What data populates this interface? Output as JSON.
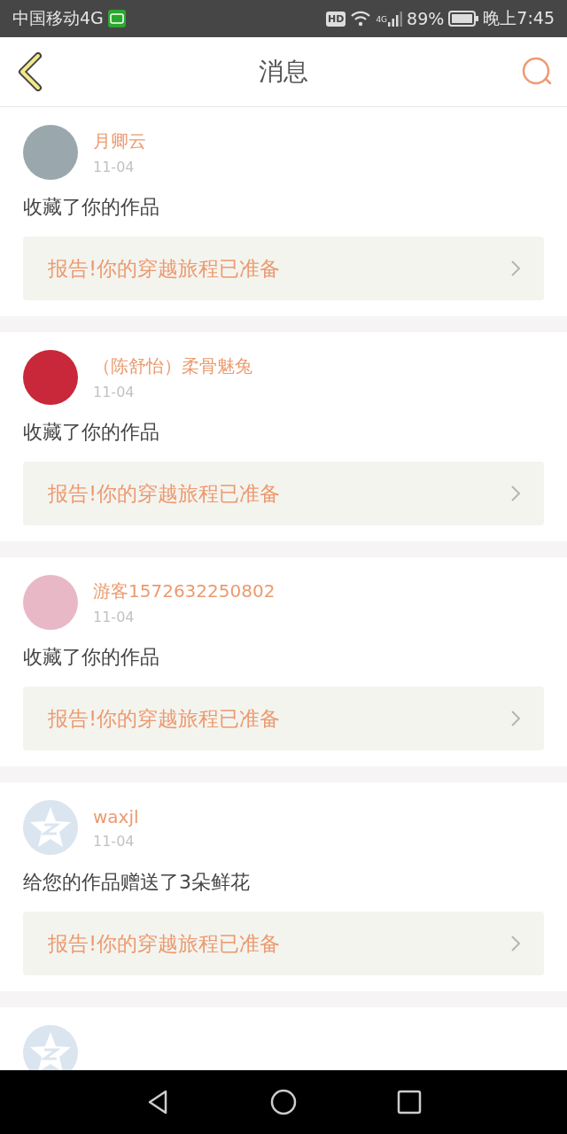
{
  "status_bar": {
    "carrier": "中国移动4G",
    "hd": "HD",
    "network": "4G",
    "battery": "89%",
    "time": "晚上7:45"
  },
  "header": {
    "title": "消息"
  },
  "messages": [
    {
      "avatar": {
        "kind": "photo",
        "color": "#9aa8ad"
      },
      "name": "月卿云",
      "date": "11-04",
      "action": "收藏了你的作品",
      "link": "报告!你的穿越旅程已准备"
    },
    {
      "avatar": {
        "kind": "photo",
        "color": "#c8283a"
      },
      "name": "（陈舒怡）柔骨魅兔",
      "date": "11-04",
      "action": "收藏了你的作品",
      "link": "报告!你的穿越旅程已准备"
    },
    {
      "avatar": {
        "kind": "photo",
        "color": "#e9b8c6"
      },
      "name": "游客1572632250802",
      "date": "11-04",
      "action": "收藏了你的作品",
      "link": "报告!你的穿越旅程已准备"
    },
    {
      "avatar": {
        "kind": "default",
        "color": "#dbe5f0"
      },
      "name": "waxjl",
      "date": "11-04",
      "action": "给您的作品赠送了3朵鲜花",
      "link": "报告!你的穿越旅程已准备"
    },
    {
      "avatar": {
        "kind": "default",
        "color": "#dbe5f0"
      }
    }
  ]
}
